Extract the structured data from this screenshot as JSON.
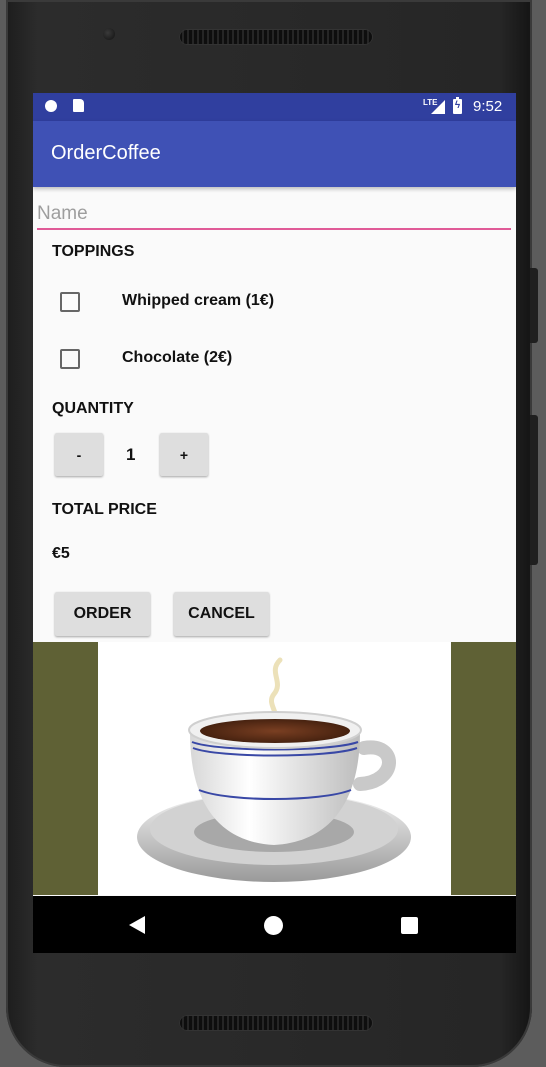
{
  "status_bar": {
    "network_label": "LTE",
    "time": "9:52",
    "icons": [
      "notification-circle-icon",
      "sd-card-icon",
      "signal-icon",
      "battery-charging-icon"
    ]
  },
  "app_bar": {
    "title": "OrderCoffee"
  },
  "name_field": {
    "placeholder": "Name",
    "value": ""
  },
  "toppings": {
    "heading": "TOPPINGS",
    "items": [
      {
        "label": "Whipped cream (1€)",
        "checked": false
      },
      {
        "label": "Chocolate (2€)",
        "checked": false
      }
    ]
  },
  "quantity": {
    "heading": "QUANTITY",
    "decrement_label": "-",
    "value": "1",
    "increment_label": "+"
  },
  "total": {
    "heading": "TOTAL PRICE",
    "value": "€5"
  },
  "actions": {
    "order_label": "ORDER",
    "cancel_label": "CANCEL"
  },
  "image": {
    "icon": "coffee-cup-icon"
  },
  "nav_bar": {
    "icons": [
      "back-icon",
      "home-icon",
      "recents-icon"
    ]
  },
  "colors": {
    "status_bar": "#303f9f",
    "app_bar": "#3f51b5",
    "input_underline": "#e05a97",
    "image_background": "#5f6135"
  }
}
